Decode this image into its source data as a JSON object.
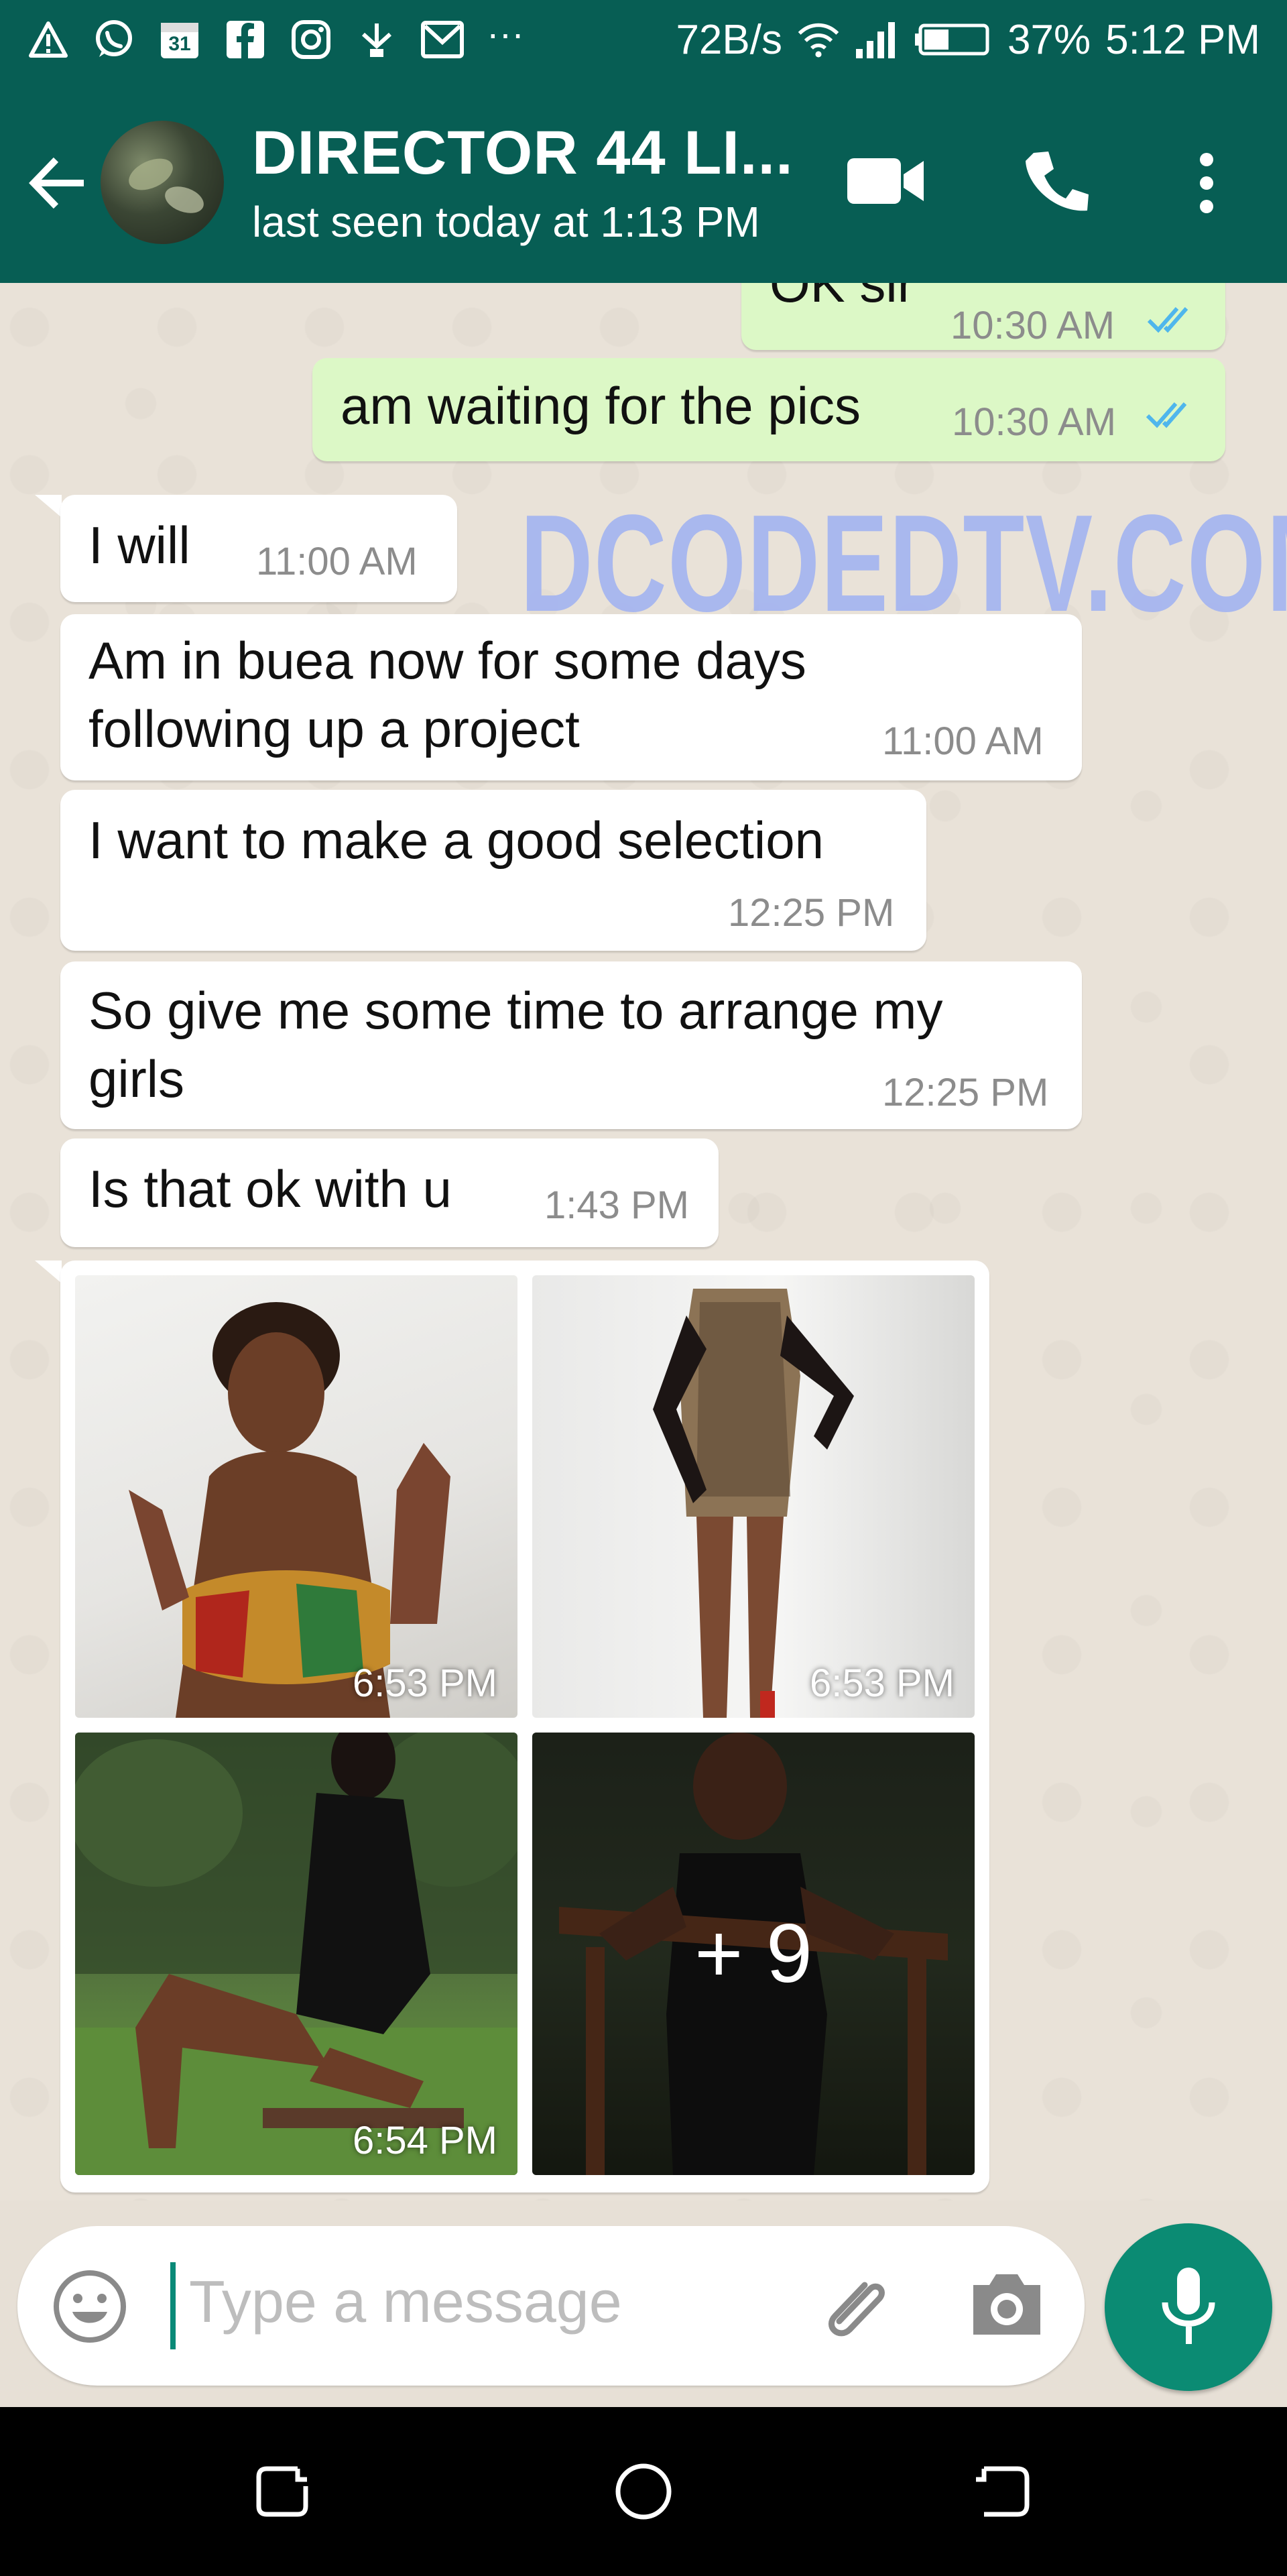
{
  "status_bar": {
    "calendar_day": "31",
    "net_speed": "72B/s",
    "battery": "37%",
    "time": "5:12 PM",
    "more": "···"
  },
  "header": {
    "contact_name": "DIRECTOR 44 LI...",
    "last_seen": "last seen today at 1:13 PM"
  },
  "watermark": "DCODEDTV.COM",
  "messages": [
    {
      "dir": "out",
      "text": "OK sir",
      "time": "10:30 AM"
    },
    {
      "dir": "out",
      "text": "am waiting for the pics",
      "time": "10:30 AM"
    },
    {
      "dir": "in",
      "text": "I will",
      "time": "11:00 AM"
    },
    {
      "dir": "in",
      "line1": "Am in buea now for some days",
      "line2": "following up a project",
      "time": "11:00 AM"
    },
    {
      "dir": "in",
      "text": "I want to make a good selection",
      "time": "12:25 PM"
    },
    {
      "dir": "in",
      "line1": "So give me some time to arrange my",
      "line2": "girls",
      "time": "12:25 PM"
    },
    {
      "dir": "in",
      "text": "Is that ok with u",
      "time": "1:43 PM"
    }
  ],
  "photo_album": {
    "photos": [
      {
        "time": "6:53 PM"
      },
      {
        "time": "6:53 PM"
      },
      {
        "time": "6:54 PM"
      }
    ],
    "more_count": "+ 9"
  },
  "composer": {
    "placeholder": "Type a message"
  },
  "icons": [
    "back-arrow-icon",
    "video-call-icon",
    "voice-call-icon",
    "more-vert-icon",
    "emoji-icon",
    "attach-icon",
    "camera-icon",
    "mic-icon",
    "recents-icon",
    "home-icon",
    "nav-back-icon"
  ],
  "colors": {
    "header": "#075e54",
    "outgoing": "#dcf8c6",
    "incoming": "#ffffff",
    "mic": "#0b8b73",
    "ticks": "#4fb6ec"
  }
}
